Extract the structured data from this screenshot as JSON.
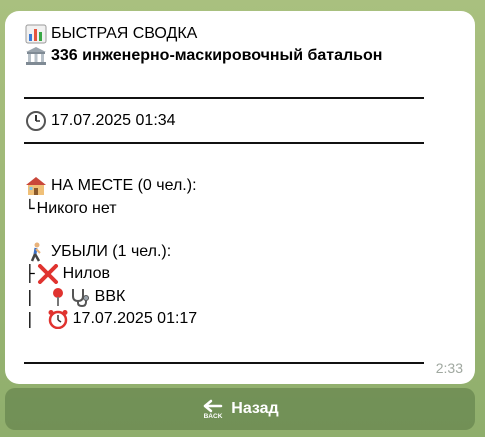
{
  "message": {
    "title": "БЫСТРАЯ СВОДКА",
    "unit": "336 инженерно-маскировочный батальон",
    "datetime": "17.07.2025 01:34",
    "present_header": "НА МЕСТЕ (0 чел.):",
    "present_tree": "└",
    "present_empty": "Никого нет",
    "left_header": "УБЫЛИ (1 чел.):",
    "person_tree": "├",
    "person_name": "Нилов",
    "sub_tree_1": "|",
    "reason": "ВВК",
    "sub_tree_2": "|",
    "reason_time": "17.07.2025 01:17",
    "sent_time": "2:33"
  },
  "keyboard": {
    "back_label": "Назад",
    "back_icon_text": "BACK"
  },
  "icons": {
    "title": "chart-icon",
    "unit": "classical-building-icon",
    "datetime": "clock-icon",
    "present": "house-icon",
    "left": "walking-person-icon",
    "person": "cross-mark-icon",
    "reason_pin": "pushpin-icon",
    "reason": "stethoscope-icon",
    "reason_time": "alarm-clock-icon",
    "back": "back-arrow-icon"
  },
  "colors": {
    "background": "#9fb877",
    "bubble": "#ffffff",
    "cross": "#e0332f",
    "button": "#6f8f5a"
  }
}
